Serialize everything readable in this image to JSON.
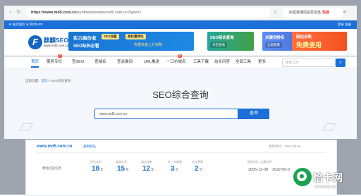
{
  "browser": {
    "url_host": "https://www.md5.com.cn",
    "url_rest": "/synthesize/www.md5.com.cn?type=1",
    "search_text": "斛斌我懂招是否给惑",
    "search_hot": "热搜"
  },
  "topstrip": {
    "left": "▣ 站点监控  ▣ 移动APP",
    "right": "登录 注册"
  },
  "header": {
    "logo_name": "麒麟SEO网",
    "logo_url": "www.md5.com.cn",
    "banner1": {
      "title": "实力高价收",
      "tag1": "SEO流量",
      "tag2": "高权重网站",
      "line2": "SEO站长必看",
      "line3": "权重快速上升攻略"
    },
    "banner2": {
      "title": "SEO综合查询",
      "button": "点击查询"
    },
    "banner3": {
      "title": "关键词排名",
      "button": "立即查看"
    },
    "banner4": {
      "title": "网站诊断",
      "big": "免费使用"
    }
  },
  "nav": {
    "items": [
      {
        "label": "首页",
        "active": true
      },
      {
        "label": "服务专栏",
        "badge": "热"
      },
      {
        "label": "查SEO"
      },
      {
        "label": "查域名"
      },
      {
        "label": "查关键词"
      },
      {
        "label": "URL推送"
      },
      {
        "label": "一口价域名",
        "badge": "新"
      },
      {
        "label": "工具下载"
      },
      {
        "label": "站长问答"
      },
      {
        "label": "全部工具"
      },
      {
        "label": "更多"
      }
    ],
    "search_placeholder": "搜索工具",
    "search_icon": "search-icon"
  },
  "hero": {
    "breadcrumb_prefix": "当前位置：",
    "breadcrumb_home": "首页",
    "breadcrumb_sep": " > ",
    "breadcrumb_current": "SEO综合查询",
    "title": "SEO综合查询",
    "query_value": "www.md5.com.cn",
    "query_button": "查询"
  },
  "result": {
    "domain": "www.md5.com.cn",
    "copy_link": "复制网址",
    "update_time": "更新时间：2022-09-26",
    "row_label": "建站历史信息",
    "stats": [
      {
        "label": "历史年份",
        "value": "18",
        "unit": "年"
      },
      {
        "label": "收录信息",
        "value": "15",
        "unit": "条"
      },
      {
        "label": "域名年龄",
        "value": "12",
        "unit": "年"
      },
      {
        "label": "近一年备案",
        "value": "3",
        "unit": "次"
      },
      {
        "label": "近年更新",
        "value": "2",
        "unit": "次"
      }
    ],
    "dates_label": "注册时间 / 过期时间",
    "date1": "2005-12-08",
    "date2": "2022-05-0"
  },
  "watermark": {
    "text": "恰卡网",
    "url": "www.qiaqa.com"
  }
}
